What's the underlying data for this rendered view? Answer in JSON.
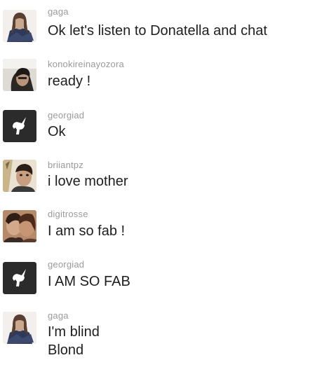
{
  "messages": [
    {
      "avatar": "gaga-avatar",
      "username": "gaga",
      "lines": [
        "Ok let's listen to Donatella and chat"
      ]
    },
    {
      "avatar": "konokireinayozora-avatar",
      "username": "konokireinayozora",
      "lines": [
        "ready !"
      ]
    },
    {
      "avatar": "unicorn-icon",
      "username": "georgiad",
      "lines": [
        "Ok"
      ]
    },
    {
      "avatar": "briiantpz-avatar",
      "username": "briiantpz",
      "lines": [
        "i love mother"
      ]
    },
    {
      "avatar": "digitrosse-avatar",
      "username": "digitrosse",
      "lines": [
        "I am so fab !"
      ]
    },
    {
      "avatar": "unicorn-icon",
      "username": "georgiad",
      "lines": [
        "I AM SO FAB"
      ]
    },
    {
      "avatar": "gaga-avatar",
      "username": "gaga",
      "lines": [
        "I'm blind",
        "Blond"
      ]
    }
  ],
  "colors": {
    "username": "#9a9a9a",
    "message_text": "#1e1e1e",
    "unicorn_avatar_bg": "#2b2b2b"
  }
}
